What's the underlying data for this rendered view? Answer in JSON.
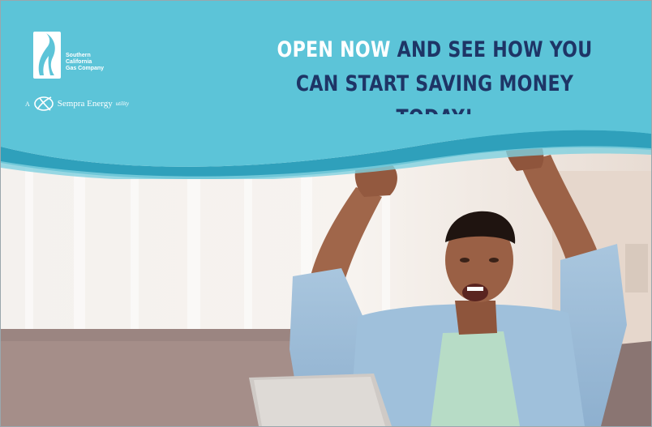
{
  "brand": {
    "company_lines": [
      "Southern",
      "California",
      "Gas Company"
    ],
    "sempra_prefix": "A",
    "sempra_name": "Sempra Energy",
    "sempra_suffix": "utility"
  },
  "headline": {
    "line1_white": "OPEN NOW",
    "line1_navy": " AND SEE HOW YOU",
    "line2_navy": "CAN START SAVING MONEY TODAY!"
  },
  "colors": {
    "header_teal": "#5cc4d8",
    "headline_navy": "#1e3566",
    "wave_dark": "#2fa0bb"
  },
  "photo": {
    "subject": "man-celebrating-at-laptop"
  }
}
